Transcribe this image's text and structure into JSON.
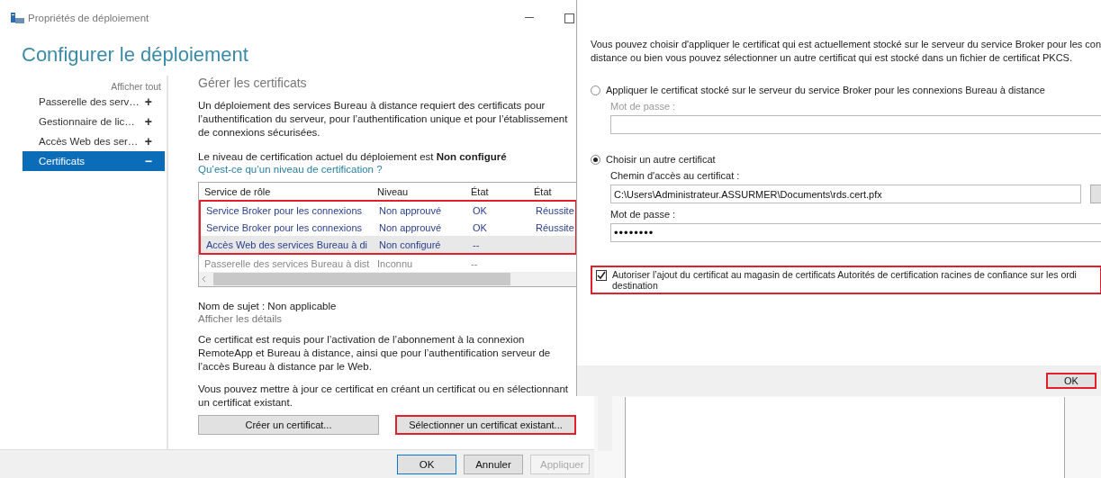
{
  "window": {
    "title": "Propriétés de déploiement"
  },
  "heading": "Configurer le déploiement",
  "sidebar": {
    "show_all": "Afficher tout",
    "items": [
      {
        "label": "Passerelle des serv…",
        "sign": "+",
        "selected": false
      },
      {
        "label": "Gestionnaire de lic…",
        "sign": "+",
        "selected": false
      },
      {
        "label": "Accès Web des ser…",
        "sign": "+",
        "selected": false
      },
      {
        "label": "Certificats",
        "sign": "−",
        "selected": true
      }
    ]
  },
  "section": {
    "title": "Gérer les certificats",
    "intro": "Un déploiement des services Bureau à distance requiert des certificats pour l’authentification du serveur, pour l’authentification unique et pour l’établissement de connexions sécurisées.",
    "level_text": "Le niveau de certification actuel du déploiement est **Non configuré**",
    "level_link": "Qu’est-ce qu’un niveau de certification ?"
  },
  "table": {
    "columns": [
      "Service de rôle",
      "Niveau",
      "État",
      "État"
    ],
    "rows": [
      {
        "cells": [
          "Service Broker pour les connexions",
          "Non approuvé",
          "OK",
          "Réussite"
        ],
        "selected": false,
        "disabled": false,
        "highlighted": true
      },
      {
        "cells": [
          "Service Broker pour les connexions",
          "Non approuvé",
          "OK",
          "Réussite"
        ],
        "selected": false,
        "disabled": false,
        "highlighted": true
      },
      {
        "cells": [
          "Accès Web des services Bureau à di",
          "Non configuré",
          "--"
        ],
        "selected": true,
        "disabled": false,
        "highlighted": true
      },
      {
        "cells": [
          "Passerelle des services Bureau à dist",
          "Inconnu",
          "--"
        ],
        "selected": false,
        "disabled": true,
        "highlighted": false
      }
    ]
  },
  "subject": "Nom de sujet : Non applicable",
  "details_link": "Afficher les détails",
  "description": "Ce certificat est requis pour l’activation de l’abonnement à la connexion RemoteApp et Bureau à distance, ainsi que pour l’authentification serveur de l’accès Bureau à distance par le Web.",
  "update_note": "Vous pouvez mettre à jour ce certificat en créant un certificat ou en sélectionnant un certificat existant.",
  "buttons": [
    {
      "label": "Créer un certificat...",
      "highlighted": false
    },
    {
      "label": "Sélectionner un certificat existant...",
      "highlighted": true
    }
  ],
  "footer_buttons": [
    {
      "label": "OK",
      "disabled": false,
      "default": true
    },
    {
      "label": "Annuler",
      "disabled": false,
      "default": false
    },
    {
      "label": "Appliquer",
      "disabled": true,
      "default": false
    }
  ],
  "dialog": {
    "intro_lines": [
      "Vous pouvez choisir d'appliquer le certificat qui est actuellement stocké sur le serveur du service Broker pour les con",
      "distance ou bien vous pouvez sélectionner un autre certificat qui est stocké dans un fichier de certificat PKCS."
    ],
    "options": [
      {
        "label": "Appliquer le certificat stocké sur le serveur du service Broker pour les connexions Bureau à distance",
        "selected": false,
        "fields": [
          {
            "label": "Mot de passe :",
            "kind": "password",
            "disabled": true
          }
        ]
      },
      {
        "label": "Choisir un autre certificat",
        "selected": true,
        "fields": [
          {
            "label": "Chemin d'accès au certificat :",
            "kind": "path",
            "disabled": false,
            "value": "C:\\Users\\Administrateur.ASSURMER\\Documents\\rds.cert.pfx"
          },
          {
            "label": "Mot de passe :",
            "kind": "password",
            "disabled": false,
            "value": "••••••••"
          }
        ]
      }
    ],
    "trust_checkbox": {
      "lines": [
        "Autoriser l’ajout du certificat au magasin de certificats Autorités de certification racines de confiance sur les ordi",
        "destination"
      ],
      "checked": true,
      "highlighted": true
    },
    "ok_button": {
      "label": "OK",
      "highlighted": true
    }
  }
}
